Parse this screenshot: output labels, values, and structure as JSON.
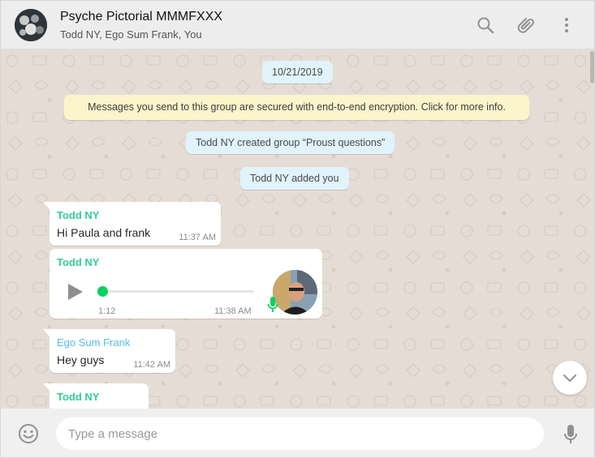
{
  "header": {
    "title": "Psyche Pictorial MMMFXXX",
    "participants": "Todd NY, Ego Sum Frank, You",
    "icons": [
      "search-icon",
      "attach-icon",
      "menu-icon"
    ]
  },
  "chat": {
    "date_chip": "10/21/2019",
    "encryption_notice": "Messages you send to this group are secured with end-to-end encryption. Click for more info.",
    "system_messages": [
      "Todd NY created group “Proust questions”",
      "Todd NY added you"
    ],
    "messages": [
      {
        "sender": "Todd NY",
        "text": "Hi Paula and frank",
        "time": "11:37 AM"
      },
      {
        "sender": "Todd NY",
        "type": "voice",
        "duration": "1:12",
        "time": "11:38 AM",
        "progress": 0
      },
      {
        "sender": "Ego Sum Frank",
        "text": "Hey guys",
        "time": "11:42 AM"
      },
      {
        "sender": "Todd NY",
        "text": ""
      }
    ]
  },
  "footer": {
    "placeholder": "Type a message",
    "icons": [
      "emoji-icon",
      "microphone-icon"
    ]
  },
  "colors": {
    "chat_background": "#e5ddd5",
    "header_background": "#ededed",
    "system_chip": "#e1f3fb",
    "notice": "#fcf4cb",
    "sender_todd": "#35cd96",
    "sender_frank": "#53bdeb",
    "voice_accent": "#09d261"
  }
}
